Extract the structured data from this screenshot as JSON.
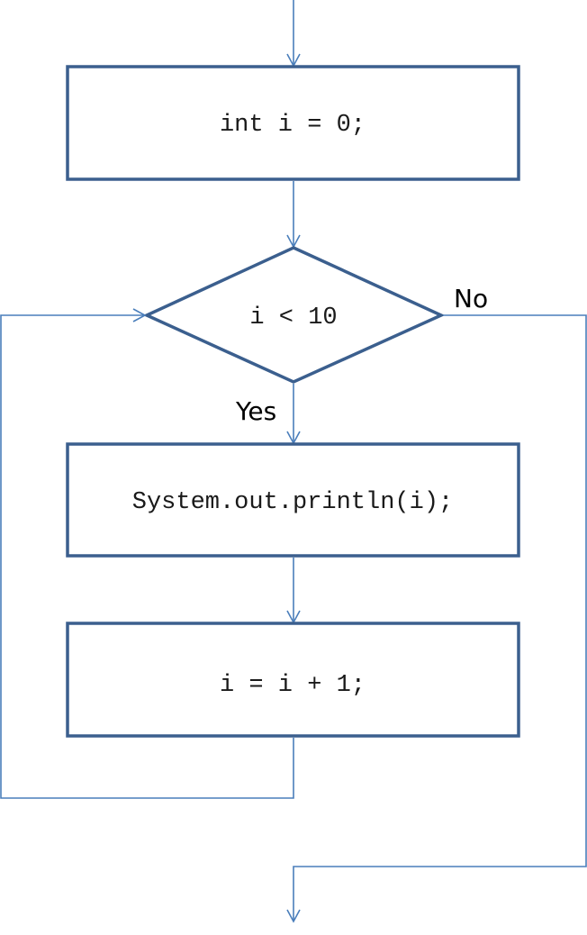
{
  "flowchart": {
    "nodes": [
      {
        "id": "init",
        "type": "process",
        "text": "int i = 0;"
      },
      {
        "id": "cond",
        "type": "decision",
        "text": "i < 10"
      },
      {
        "id": "print",
        "type": "process",
        "text": "System.out.println(i);"
      },
      {
        "id": "incr",
        "type": "process",
        "text": "i = i + 1;"
      }
    ],
    "edges": [
      {
        "from": "start",
        "to": "init",
        "label": ""
      },
      {
        "from": "init",
        "to": "cond",
        "label": ""
      },
      {
        "from": "cond",
        "to": "print",
        "label": "Yes"
      },
      {
        "from": "print",
        "to": "incr",
        "label": ""
      },
      {
        "from": "incr",
        "to": "cond",
        "label": ""
      },
      {
        "from": "cond",
        "to": "end",
        "label": "No"
      }
    ],
    "labels": {
      "yes": "Yes",
      "no": "No"
    }
  }
}
